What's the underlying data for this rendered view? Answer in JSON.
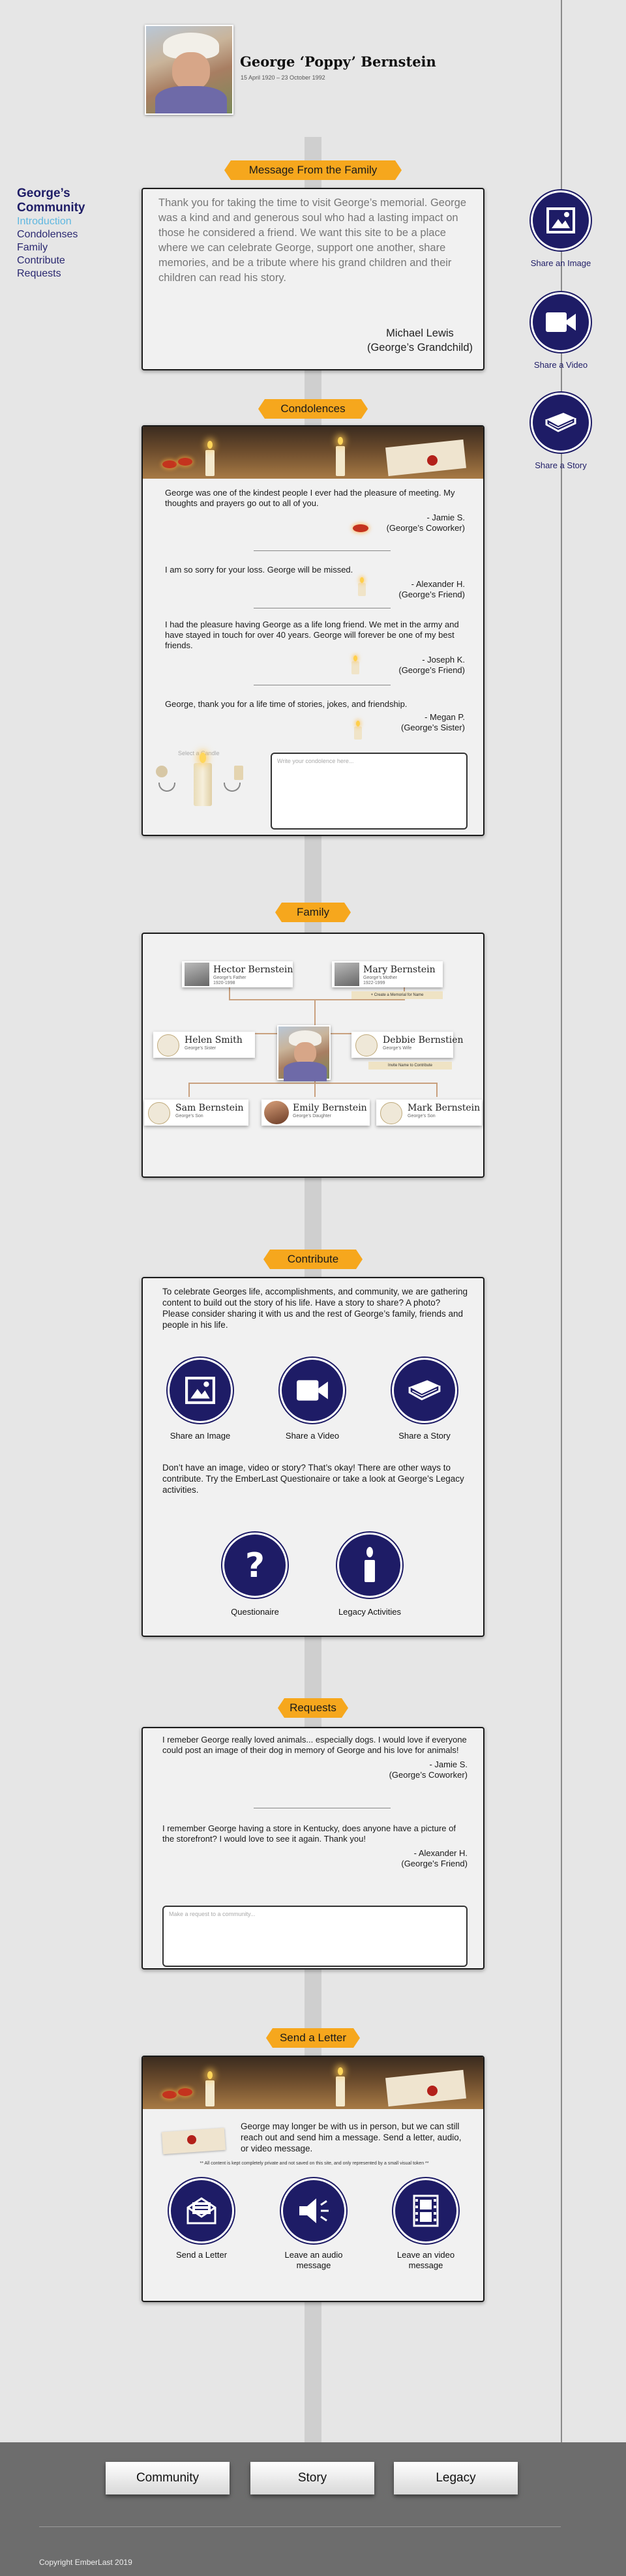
{
  "header": {
    "name": "George ‘Poppy’ Bernstein",
    "dates": "15 April 1920 – 23 October 1992"
  },
  "nav": {
    "title": "George’s Community",
    "items": [
      "Introduction",
      "Condolenses",
      "Family",
      "Contribute",
      "Requests"
    ]
  },
  "share": {
    "image": "Share an Image",
    "video": "Share a Video",
    "story": "Share a Story"
  },
  "message": {
    "tag": "Message From the Family",
    "body": "Thank you for taking the time to visit George’s memorial.  George was a kind and and generous soul who had a lasting impact on those he considered a friend. We want this site to be a place where we can celebrate George, support one another, share memories, and be a tribute where his grand children and their children can read his story.",
    "author": "Michael Lewis",
    "relation": "(George’s Grandchild)"
  },
  "condolences": {
    "tag": "Condolences",
    "entries": [
      {
        "text": "George was one of the kindest people I ever had the pleasure of meeting.  My thoughts and prayers go out to all of you.",
        "name": "- Jamie S.",
        "relation": "(George’s Coworker)"
      },
      {
        "text": "I am so sorry for your loss. George will be missed.",
        "name": "- Alexander H.",
        "relation": "(George’s Friend)"
      },
      {
        "text": "I had the pleasure having George as a life long friend.  We met in the army and have stayed in touch for over 40 years.  George will forever be one of my best friends.",
        "name": "- Joseph K.",
        "relation": "(George’s Friend)"
      },
      {
        "text": "George, thank you for a life time of stories, jokes, and friendship.",
        "name": "- Megan P.",
        "relation": "(George’s  Sister)"
      }
    ],
    "select_candle": "Select a Candle",
    "placeholder": "Write your condolence here..."
  },
  "family": {
    "tag": "Family",
    "hector": {
      "name": "Hector Bernstein",
      "role": "George’s Father",
      "years": "1920-1998"
    },
    "mary": {
      "name": "Mary Bernstein",
      "role": "George’s Mother",
      "years": "1922-1999",
      "note": "+ Create a Memorial for Name"
    },
    "helen": {
      "name": "Helen Smith",
      "role": "George’s Sister"
    },
    "debbie": {
      "name": "Debbie Bernstien",
      "role": "George’s Wife",
      "note": "Invite Name to Contribute"
    },
    "sam": {
      "name": "Sam Bernstein",
      "role": "George’s Son"
    },
    "emily": {
      "name": "Emily Bernstein",
      "role": "George’s Daughter"
    },
    "mark": {
      "name": "Mark Bernstein",
      "role": "George’s Son"
    }
  },
  "contribute": {
    "tag": "Contribute",
    "intro": "To celebrate Georges life, accomplishments, and community, we are gathering content to build out the story of his life.  Have a story to share?  A photo?  Please consider sharing it with us and the rest of George’s family, friends and people in his life.",
    "share_image": "Share an Image",
    "share_video": "Share a Video",
    "share_story": "Share a Story",
    "more": "Don’t have an image, video or story?  That’s okay!  There are other ways to contribute.  Try the EmberLast Questionaire or take a look at George’s  Legacy activities.",
    "questionaire": "Questionaire",
    "legacy": "Legacy Activities"
  },
  "requests": {
    "tag": "Requests",
    "entries": [
      {
        "text": "I remeber George really loved animals... especially dogs.  I would love if everyone could post an image of their dog in memory of George and his love for animals!",
        "name": "- Jamie S.",
        "relation": "(George’s Coworker)"
      },
      {
        "text": "I remember George having a store in Kentucky, does anyone have a picture of the storefront?  I would love to see it again.  Thank you!",
        "name": "- Alexander H.",
        "relation": "(George’s Friend)"
      }
    ],
    "placeholder": "Make a request to a community..."
  },
  "letter": {
    "tag": "Send a Letter",
    "body": "George may longer be with us in person, but we can still reach out and send him a message.  Send a letter, audio, or video message.",
    "note": "** All content is kept completely private and not saved on this site, and only represented by a small visual token **",
    "send": "Send a Letter",
    "audio": "Leave an audio message",
    "video": "Leave an video message"
  },
  "footer": {
    "community": "Community",
    "story": "Story",
    "legacy": "Legacy",
    "copyright": "Copyright EmberLast 2019"
  },
  "colors": {
    "navy": "#1e1c66",
    "accent": "#f6a71d",
    "link": "#5fb7e0"
  }
}
